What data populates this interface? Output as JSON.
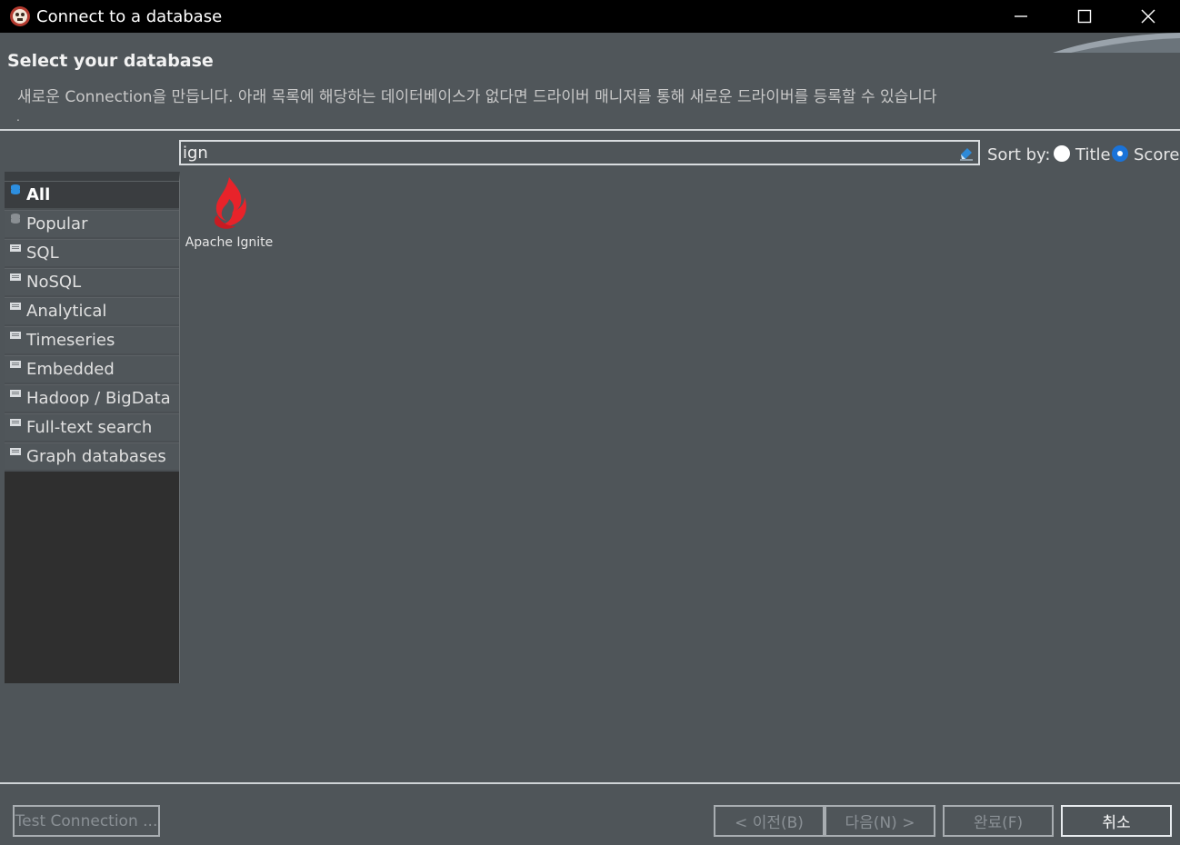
{
  "window": {
    "title": "Connect to a database",
    "minimize_icon": "minimize-icon",
    "maximize_icon": "maximize-icon",
    "close_icon": "close-icon"
  },
  "header": {
    "title": "Select your database",
    "description": "새로운 Connection을 만듭니다. 아래 목록에 해당하는 데이터베이스가 없다면 드라이버 매니저를 통해 새로운 드라이버를 등록할 수 있습니다",
    "description_tail": "."
  },
  "search": {
    "value": "ign",
    "clear_icon": "eraser-icon"
  },
  "sort": {
    "label": "Sort by:",
    "options": [
      {
        "label": "Title",
        "selected": false
      },
      {
        "label": "Score",
        "selected": true
      }
    ]
  },
  "categories": [
    {
      "label": "All",
      "selected": true,
      "icon": "database-stack-icon"
    },
    {
      "label": "Popular",
      "selected": false,
      "icon": "database-stack-icon"
    },
    {
      "label": "SQL",
      "selected": false,
      "icon": "folder-icon"
    },
    {
      "label": "NoSQL",
      "selected": false,
      "icon": "folder-icon"
    },
    {
      "label": "Analytical",
      "selected": false,
      "icon": "folder-icon"
    },
    {
      "label": "Timeseries",
      "selected": false,
      "icon": "folder-icon"
    },
    {
      "label": "Embedded",
      "selected": false,
      "icon": "folder-icon"
    },
    {
      "label": "Hadoop / BigData",
      "selected": false,
      "icon": "folder-icon"
    },
    {
      "label": "Full-text search",
      "selected": false,
      "icon": "folder-icon"
    },
    {
      "label": "Graph databases",
      "selected": false,
      "icon": "folder-icon"
    }
  ],
  "results": [
    {
      "label": "Apache Ignite",
      "icon": "apache-ignite-flame-icon",
      "color": "#e8232a"
    }
  ],
  "footer": {
    "test_connection": "Test Connection ...",
    "back": "< 이전(B)",
    "next": "다음(N) >",
    "finish": "완료(F)",
    "cancel": "취소"
  },
  "colors": {
    "background": "#4f5559",
    "titlebar": "#000000",
    "accent": "#1a73d9",
    "sidebar_dark": "#2f2f2f"
  }
}
